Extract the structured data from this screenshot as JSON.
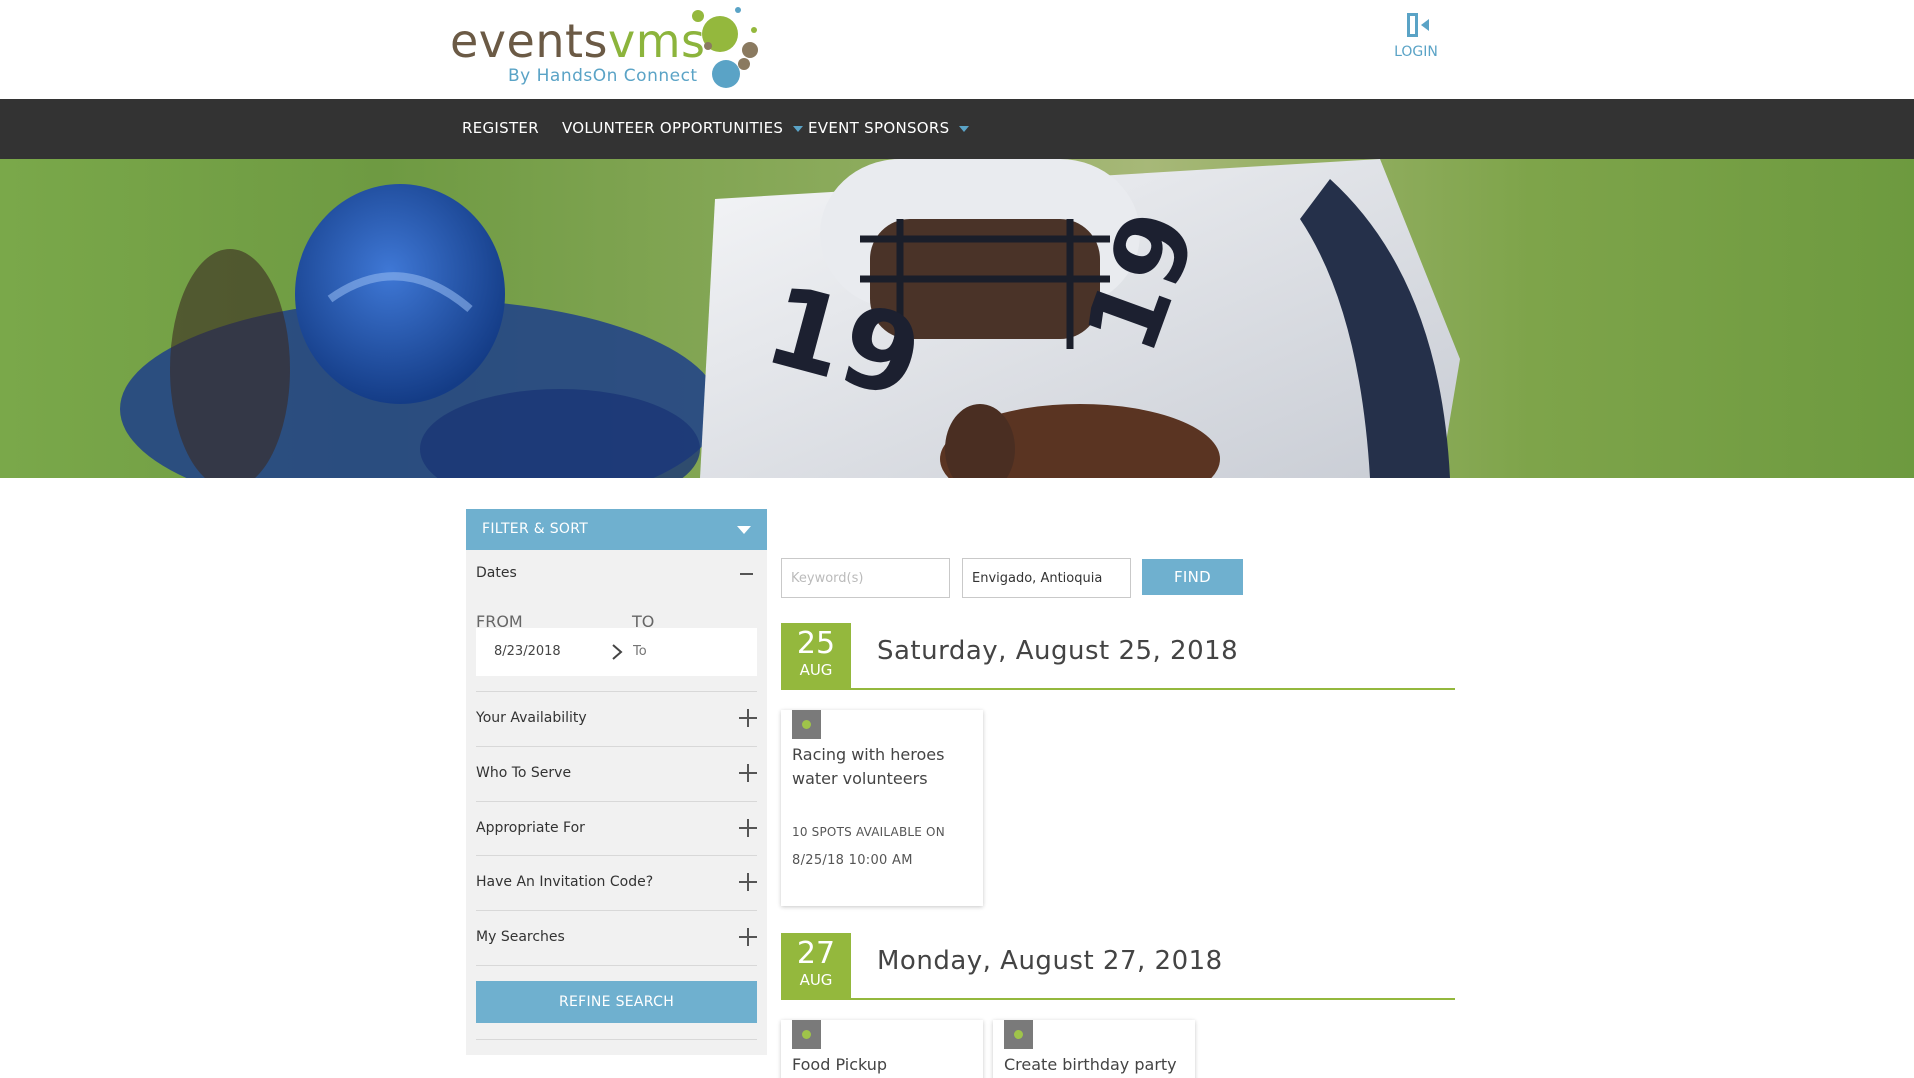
{
  "header": {
    "logo_word_part1": "events",
    "logo_word_part2": "vms",
    "logo_subtitle": "By HandsOn Connect",
    "login_label": "LOGIN"
  },
  "nav": {
    "items": [
      {
        "label": "REGISTER",
        "has_dropdown": false
      },
      {
        "label": "VOLUNTEER OPPORTUNITIES",
        "has_dropdown": true
      },
      {
        "label": "EVENT SPONSORS",
        "has_dropdown": true
      }
    ]
  },
  "sidebar": {
    "header_label": "FILTER & SORT",
    "dates_label": "Dates",
    "from_label": "FROM",
    "to_label": "TO",
    "from_value": "8/23/2018",
    "to_placeholder": "To",
    "filters": [
      "Your Availability",
      "Who To Serve",
      "Appropriate For",
      "Have An Invitation Code?",
      "My Searches"
    ],
    "refine_label": "REFINE SEARCH"
  },
  "search": {
    "keyword_placeholder": "Keyword(s)",
    "location_value": "Envigado, Antioquia",
    "find_label": "FIND"
  },
  "days": [
    {
      "day": "25",
      "month": "AUG",
      "title": "Saturday, August 25, 2018",
      "cards": [
        {
          "title": "Racing with heroes water volunteers",
          "spots": "10 SPOTS AVAILABLE ON",
          "datetime": "8/25/18 10:00 AM"
        }
      ]
    },
    {
      "day": "27",
      "month": "AUG",
      "title": "Monday, August 27, 2018",
      "cards": [
        {
          "title": "Food Pickup"
        },
        {
          "title": "Create birthday party"
        }
      ]
    }
  ],
  "colors": {
    "accent_blue": "#6fb0cf",
    "accent_green": "#94b83d",
    "nav_bg": "#333333",
    "sidebar_bg": "#f1f1f1"
  }
}
